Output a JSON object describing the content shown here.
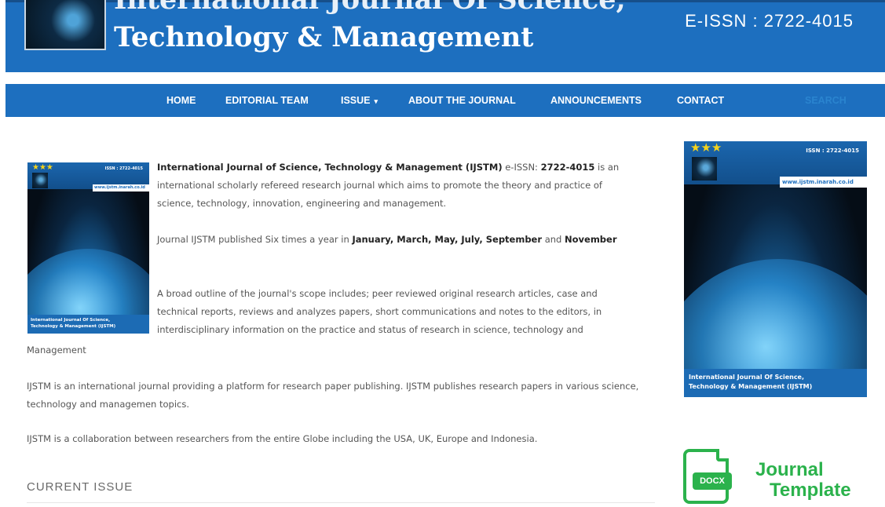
{
  "header": {
    "title_line1": "International Journal Of Science,",
    "title_line2": "Technology & Management",
    "eissn": "E-ISSN : 2722-4015"
  },
  "nav": {
    "items": [
      "HOME",
      "EDITORIAL TEAM",
      "ISSUE",
      "ABOUT THE JOURNAL",
      "ANNOUNCEMENTS",
      "CONTACT"
    ],
    "issue_caret": "▾",
    "search_label": "SEARCH"
  },
  "cover": {
    "stars": "★★★",
    "issn": "ISSN : 2722-4015",
    "url_small": "www.ijstm.inarah.co.id",
    "url_large": "www.ijstm.inarah.co.id",
    "title_line1": "International Journal Of Science,",
    "title_line2": "Technology & Management (IJSTM)"
  },
  "main": {
    "p1_bold": "International Journal of Science, Technology & Management (IJSTM)",
    "p1_eissn_label": " e-ISSN: ",
    "p1_eissn_value": "2722-4015",
    "p1_rest": " is an international scholarly refereed research journal which aims to promote the theory and practice of science, technology, innovation, engineering and management.",
    "p2_start": "Journal IJSTM published Six times a year in ",
    "p2_months": "January, March, May, July, September",
    "p2_and": " and ",
    "p2_last": "November",
    "p3": "A broad outline of the journal's scope includes; peer reviewed original research articles, case and technical reports, reviews and analyzes papers, short communications and notes to the editors, in interdisciplinary information on the practice and status of research in science, technology and",
    "p3_last_line": "Management",
    "p4": "IJSTM is an international journal providing a platform for research paper publishing. IJSTM publishes research papers in various science, technology and managemen topics.",
    "p5": "IJSTM is a collaboration between researchers from the entire Globe including the USA, UK, Europe and Indonesia.",
    "current_issue": "CURRENT ISSUE"
  },
  "template_badge": {
    "docx": "DOCX",
    "line1": "Journal",
    "line2": "Template"
  },
  "colors": {
    "brand_blue": "#1d6fbf",
    "accent_green": "#2bb24c"
  }
}
